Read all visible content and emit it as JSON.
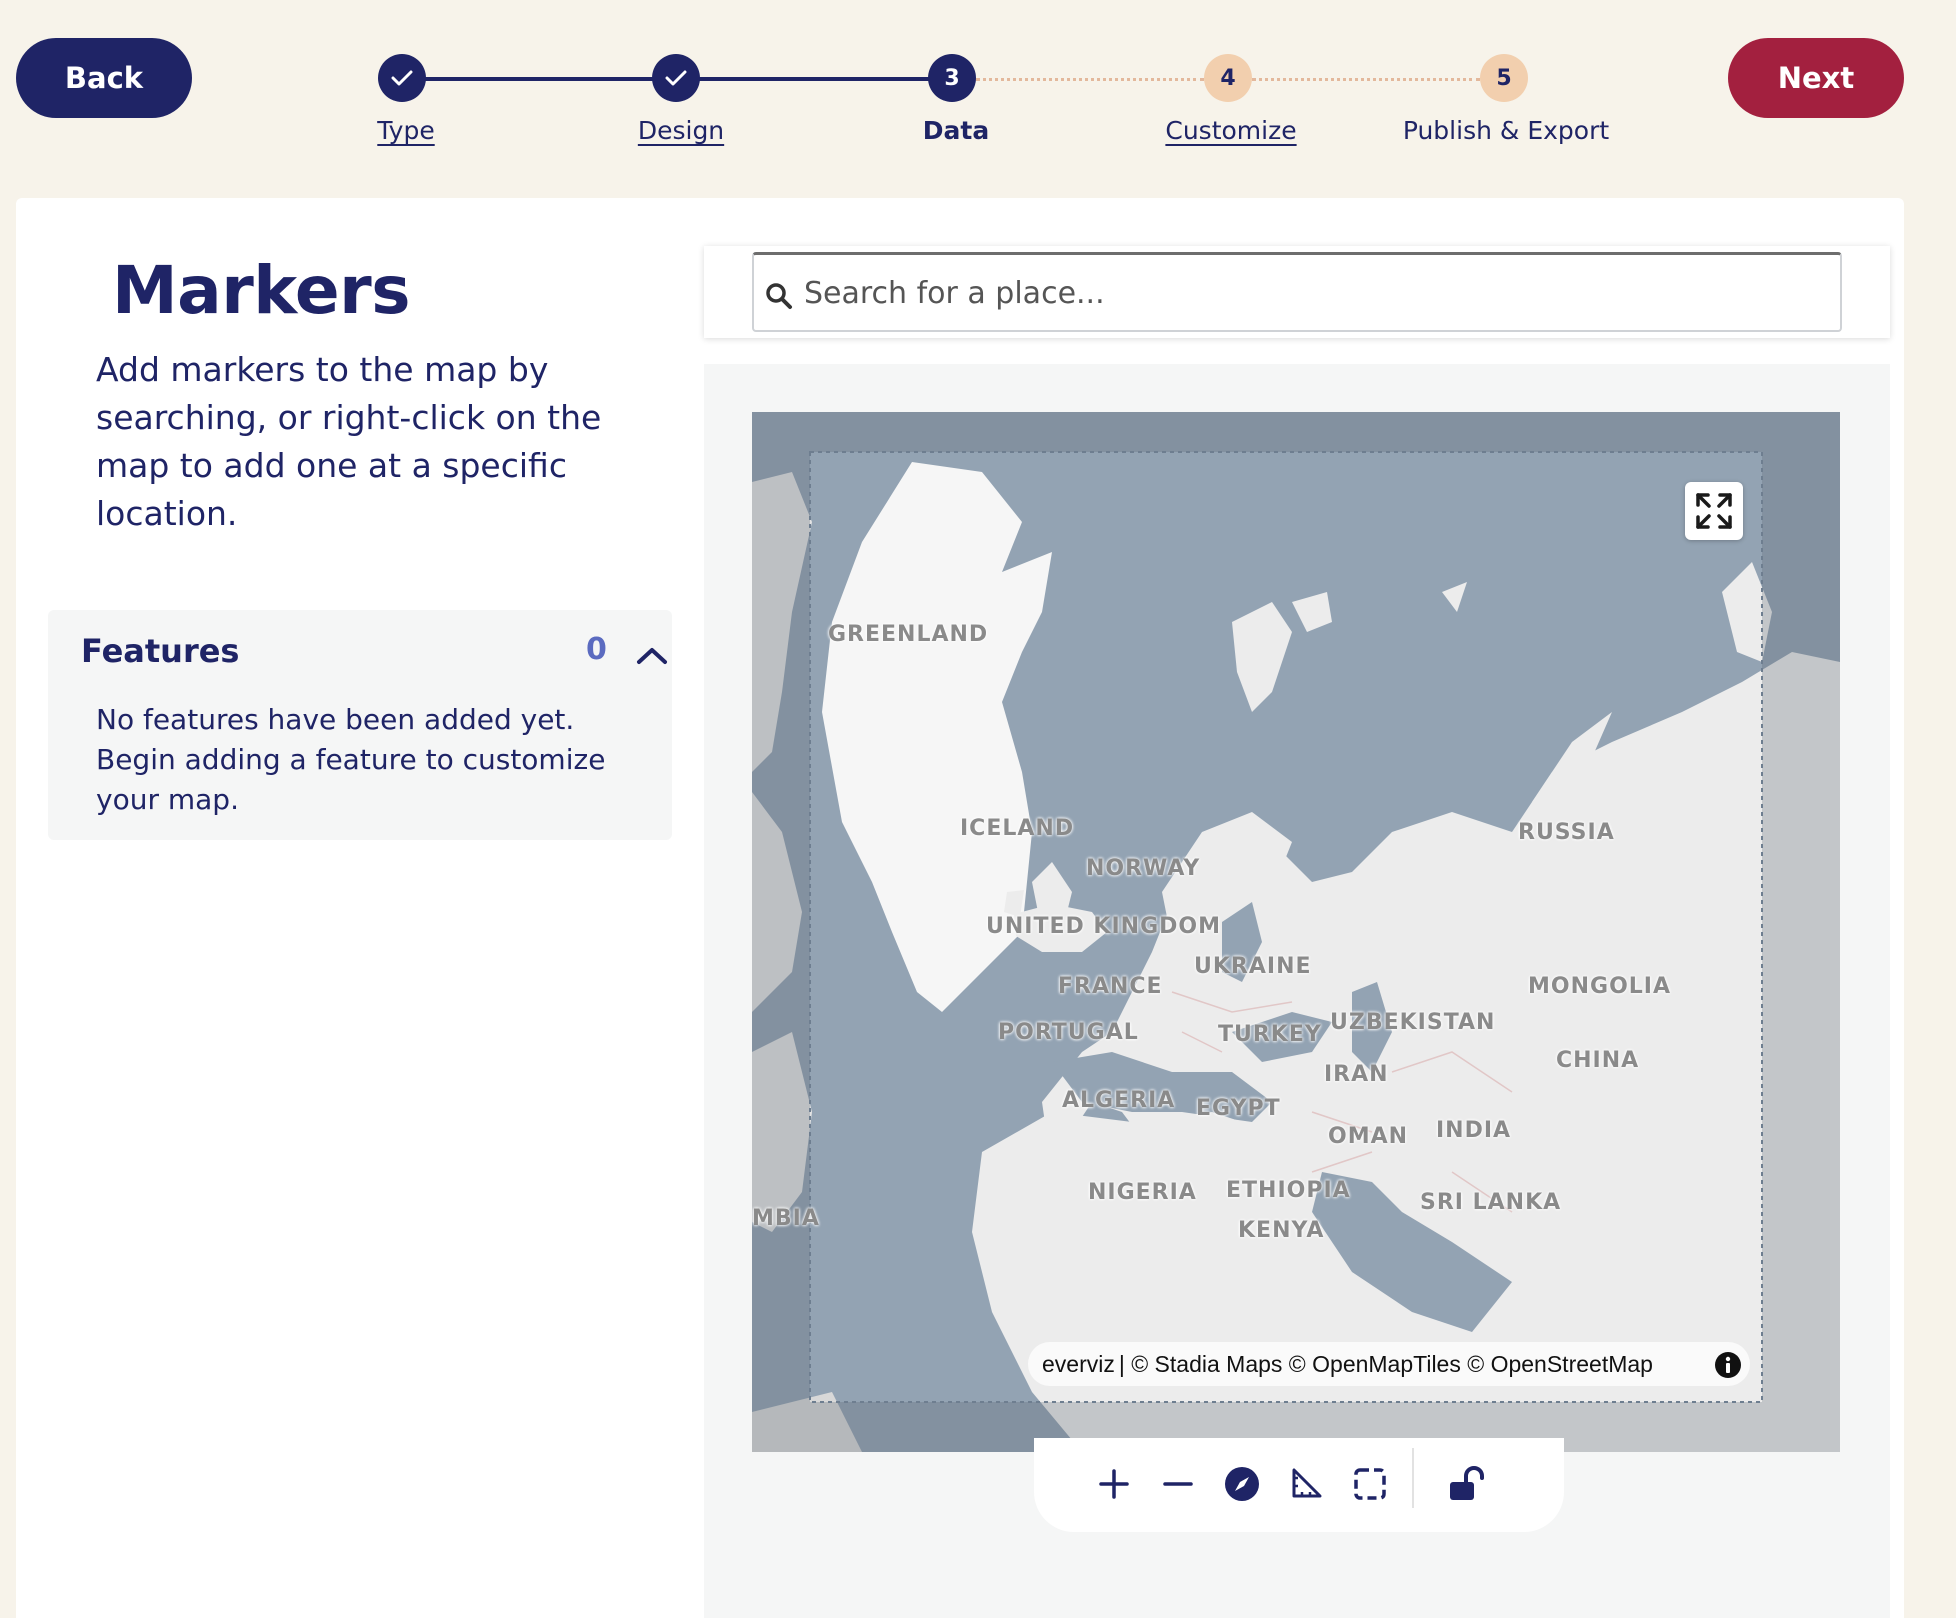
{
  "nav": {
    "back_label": "Back",
    "next_label": "Next",
    "steps": [
      {
        "number": "1",
        "label": "Type",
        "state": "done"
      },
      {
        "number": "2",
        "label": "Design",
        "state": "done"
      },
      {
        "number": "3",
        "label": "Data",
        "state": "active"
      },
      {
        "number": "4",
        "label": "Customize",
        "state": "todo"
      },
      {
        "number": "5",
        "label": "Publish & Export",
        "state": "todo"
      }
    ]
  },
  "panel": {
    "title": "Markers",
    "description": "Add markers to the map by searching, or right-click on the map to add one at a specific location."
  },
  "features": {
    "title": "Features",
    "count": "0",
    "empty_message": "No features have been added yet. Begin adding a feature to customize your map."
  },
  "search": {
    "placeholder": "Search for a place..."
  },
  "map": {
    "labels": {
      "greenland": "GREENLAND",
      "iceland": "ICELAND",
      "norway": "NORWAY",
      "russia": "RUSSIA",
      "united_kingdom": "UNITED KINGDOM",
      "ukraine": "UKRAINE",
      "france": "FRANCE",
      "mongolia": "MONGOLIA",
      "portugal": "PORTUGAL",
      "turkey": "TURKEY",
      "uzbekistan": "UZBEKISTAN",
      "china": "CHINA",
      "iran": "IRAN",
      "algeria": "ALGERIA",
      "egypt": "EGYPT",
      "oman": "OMAN",
      "india": "INDIA",
      "nigeria": "NIGERIA",
      "ethiopia": "ETHIOPIA",
      "sri_lanka": "SRI LANKA",
      "kenya": "KENYA",
      "zambia_partial": "MBIA"
    },
    "attribution_brand": "everviz",
    "attribution_text": "| © Stadia Maps © OpenMapTiles © OpenStreetMap"
  },
  "colors": {
    "navy": "#1f2466",
    "next_red": "#a3203f",
    "todo_step": "#f2cfae",
    "water": "#93a3b3",
    "land": "#ececec"
  }
}
